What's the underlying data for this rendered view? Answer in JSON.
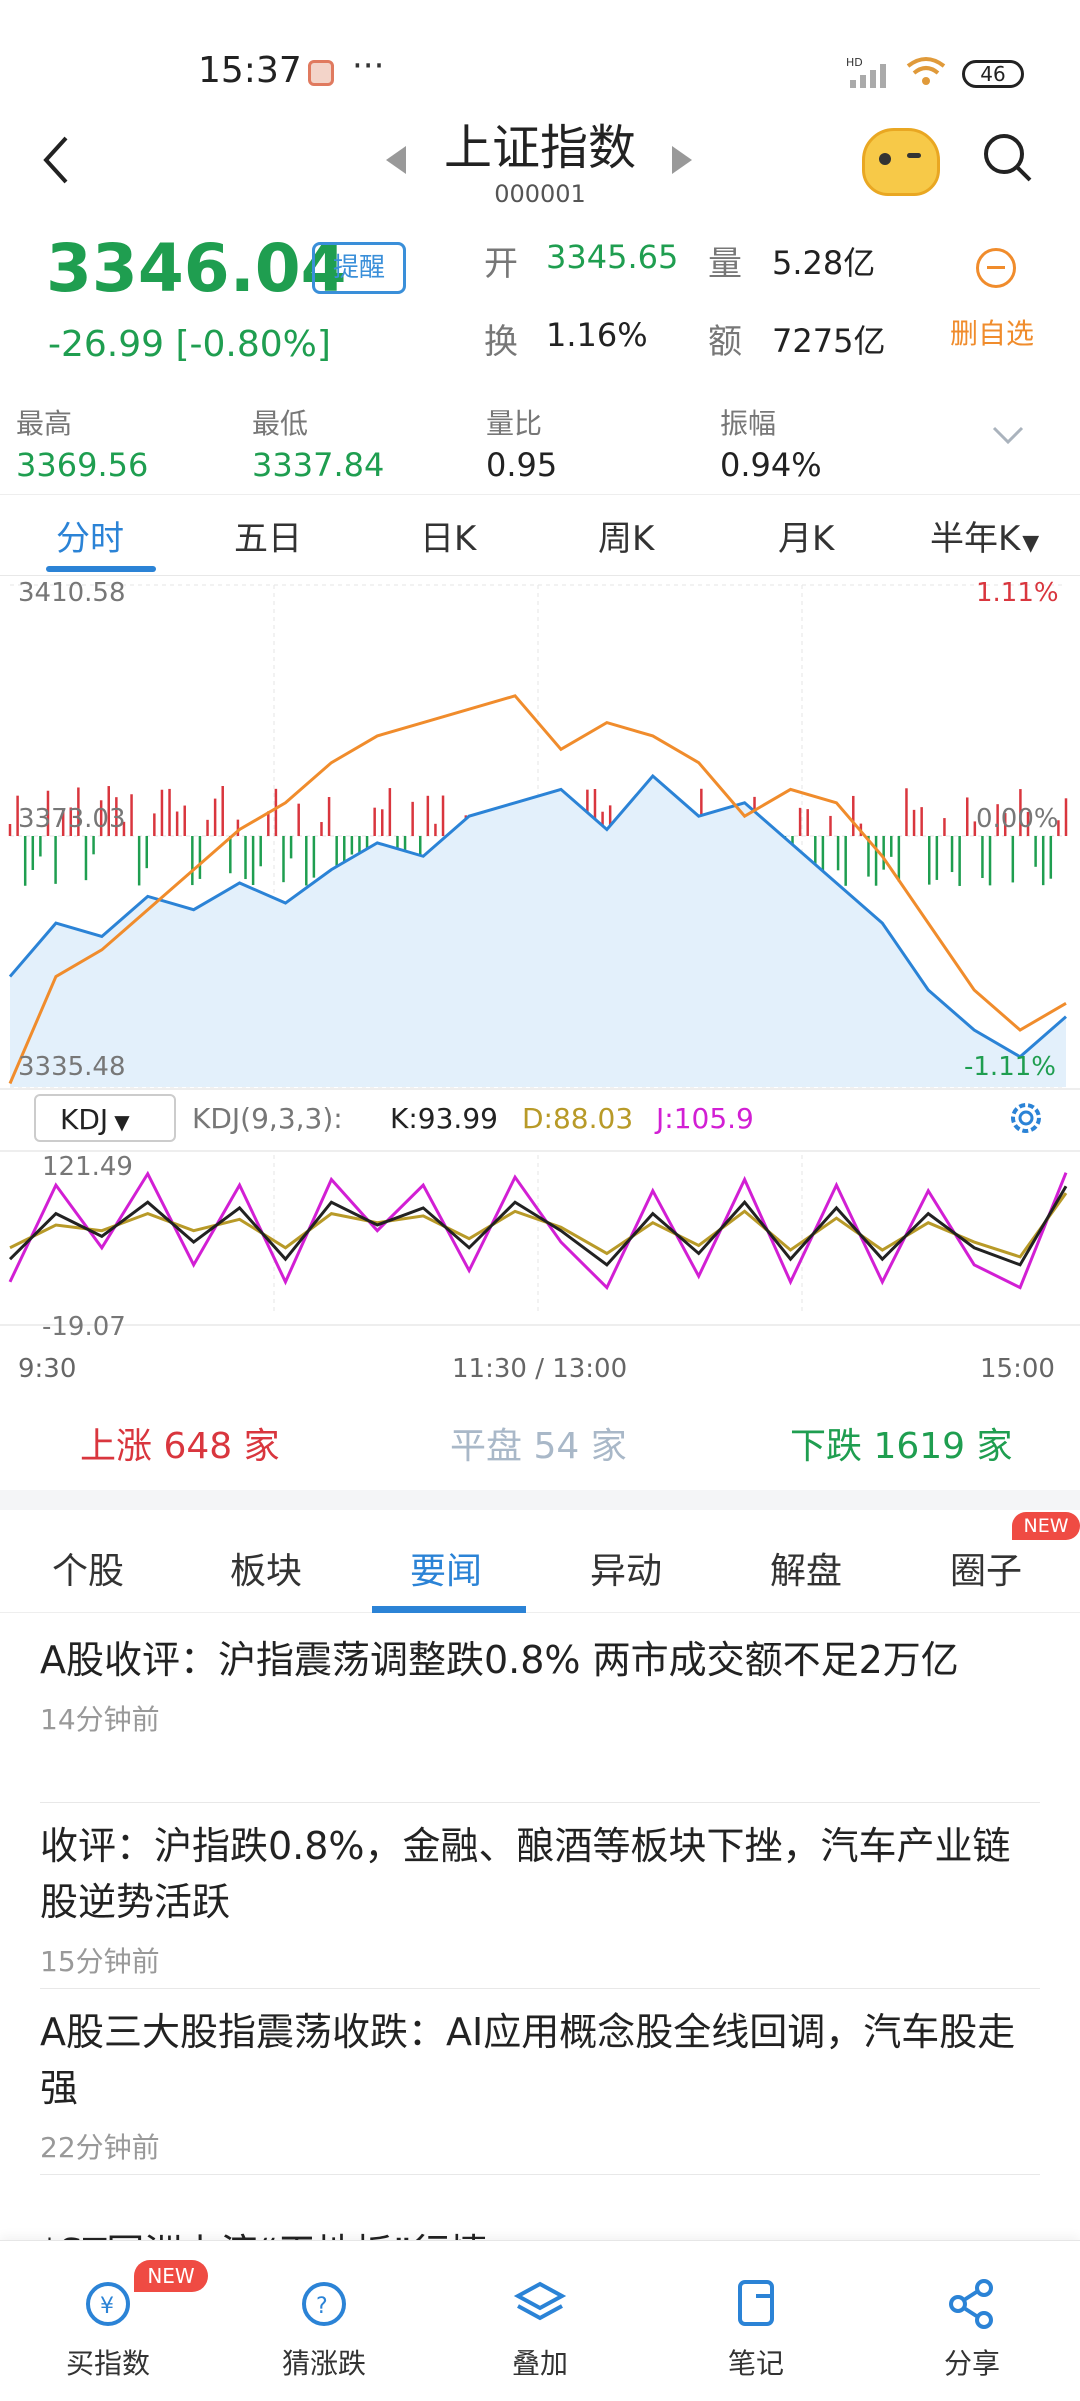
{
  "status": {
    "time": "15:37",
    "dots": "···",
    "network": "HD",
    "battery": "46"
  },
  "header": {
    "title": "上证指数",
    "code": "000001"
  },
  "quote": {
    "price": "3346.04",
    "change": "-26.99  [-0.80%]",
    "remind_label": "提醒",
    "open_label": "开",
    "open_value": "3345.65",
    "volume_label": "量",
    "volume_value": "5.28亿",
    "turnover_label": "换",
    "turnover_value": "1.16%",
    "amount_label": "额",
    "amount_value": "7275亿",
    "delete_fav_label": "删自选"
  },
  "stats": [
    {
      "label": "最高",
      "value": "3369.56"
    },
    {
      "label": "最低",
      "value": "3337.84"
    },
    {
      "label": "量比",
      "value": "0.95"
    },
    {
      "label": "振幅",
      "value": "0.94%"
    }
  ],
  "chart_tabs": [
    "分时",
    "五日",
    "日K",
    "周K",
    "月K",
    "半年K"
  ],
  "chart_data": {
    "type": "line",
    "price_axis": {
      "top": "3410.58",
      "mid": "3373.03",
      "bottom": "3335.48",
      "top_pct": "1.11%",
      "mid_pct": "0.00%",
      "bottom_pct": "-1.11%"
    },
    "ylim": [
      3335.48,
      3410.58
    ],
    "series": [
      {
        "name": "price",
        "values": [
          3352,
          3360,
          3358,
          3364,
          3362,
          3366,
          3363,
          3368,
          3372,
          3370,
          3376,
          3378,
          3380,
          3374,
          3382,
          3376,
          3378,
          3372,
          3366,
          3360,
          3350,
          3344,
          3340,
          3346
        ]
      },
      {
        "name": "avg",
        "values": [
          3336,
          3352,
          3356,
          3362,
          3368,
          3374,
          3378,
          3384,
          3388,
          3390,
          3392,
          3394,
          3386,
          3390,
          3388,
          3384,
          3376,
          3380,
          3378,
          3370,
          3360,
          3350,
          3344,
          3348
        ]
      }
    ],
    "x_ticks": [
      "9:30",
      "11:30 / 13:00",
      "15:00"
    ],
    "kdj": {
      "selector": "KDJ",
      "params": "KDJ(9,3,3):",
      "k_label": "K:93.99",
      "d_label": "D:88.03",
      "j_label": "J:105.9",
      "top": "121.49",
      "bottom": "-19.07",
      "k": [
        30,
        70,
        50,
        80,
        45,
        75,
        30,
        80,
        60,
        75,
        40,
        80,
        55,
        25,
        70,
        35,
        80,
        30,
        75,
        30,
        70,
        40,
        25,
        94
      ],
      "d": [
        40,
        60,
        55,
        70,
        55,
        65,
        40,
        70,
        62,
        68,
        48,
        72,
        58,
        35,
        62,
        42,
        72,
        38,
        66,
        38,
        62,
        45,
        32,
        88
      ],
      "j": [
        10,
        95,
        40,
        105,
        25,
        95,
        10,
        100,
        55,
        95,
        20,
        102,
        45,
        5,
        90,
        15,
        100,
        10,
        95,
        10,
        90,
        25,
        5,
        106
      ]
    }
  },
  "breadth": {
    "up_label": "上涨",
    "up_count": "648",
    "up_unit": "家",
    "flat_label": "平盘",
    "flat_count": "54",
    "flat_unit": "家",
    "down_label": "下跌",
    "down_count": "1619",
    "down_unit": "家"
  },
  "news_tabs": [
    "个股",
    "板块",
    "要闻",
    "异动",
    "解盘",
    "圈子"
  ],
  "news_new_badge": "NEW",
  "news": [
    {
      "title": "A股收评：沪指震荡调整跌0.8% 两市成交额不足2万亿",
      "time": "14分钟前"
    },
    {
      "title": "收评：沪指跌0.8%，金融、酿酒等板块下挫，汽车产业链股逆势活跃",
      "time": "15分钟前"
    },
    {
      "title": "A股三大股指震荡收跌：AI应用概念股全线回调，汽车股走强",
      "time": "22分钟前"
    }
  ],
  "news_partial": "*ST国洲上演“天地板”行情",
  "bottom_bar": {
    "new_badge": "NEW",
    "items": [
      "买指数",
      "猜涨跌",
      "叠加",
      "笔记",
      "分享"
    ]
  },
  "colors": {
    "green": "#1f9e50",
    "red": "#d9363e",
    "blue": "#2b83d6",
    "orange": "#f08c2c"
  }
}
